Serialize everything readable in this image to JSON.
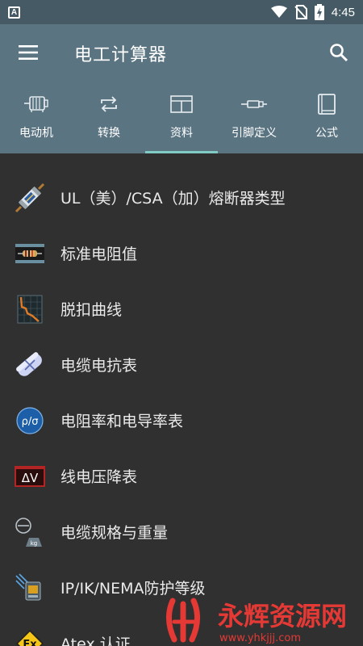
{
  "status_bar": {
    "time": "4:45",
    "icons": [
      "a-icon",
      "wifi-icon",
      "no-sim-icon",
      "battery-charging-icon"
    ]
  },
  "app_bar": {
    "title": "电工计算器",
    "menu_icon": "hamburger-menu-icon",
    "search_icon": "search-icon"
  },
  "tabs": [
    {
      "label": "电动机",
      "icon": "motor-icon",
      "active": false
    },
    {
      "label": "转换",
      "icon": "convert-icon",
      "active": false
    },
    {
      "label": "资料",
      "icon": "table-icon",
      "active": true
    },
    {
      "label": "引脚定义",
      "icon": "pin-icon",
      "active": false
    },
    {
      "label": "公式",
      "icon": "book-icon",
      "active": false
    }
  ],
  "list": [
    {
      "label": "UL（美）/CSA（加）熔断器类型",
      "icon": "fuse-icon"
    },
    {
      "label": "标准电阻值",
      "icon": "resistor-icon"
    },
    {
      "label": "脱扣曲线",
      "icon": "trip-curve-icon"
    },
    {
      "label": "电缆电抗表",
      "icon": "cable-reactance-icon"
    },
    {
      "label": "电阻率和电导率表",
      "icon": "resistivity-icon"
    },
    {
      "label": "线电压降表",
      "icon": "voltage-drop-icon"
    },
    {
      "label": "电缆规格与重量",
      "icon": "cable-weight-icon"
    },
    {
      "label": "IP/IK/NEMA防护等级",
      "icon": "protection-rating-icon"
    },
    {
      "label": "Atex 认证",
      "icon": "atex-icon"
    }
  ],
  "icon_text": {
    "resistivity": "ρ/σ",
    "voltage_drop": "ΔV",
    "atex": "Ex",
    "weight": "kg"
  },
  "watermark": {
    "title": "永辉资源网",
    "url": "www.yhkjjj.com"
  },
  "colors": {
    "status_bar": "#455a64",
    "app_bar": "#5a7482",
    "background": "#303030",
    "tab_indicator": "#80cbc4",
    "watermark_red": "#e53935"
  }
}
